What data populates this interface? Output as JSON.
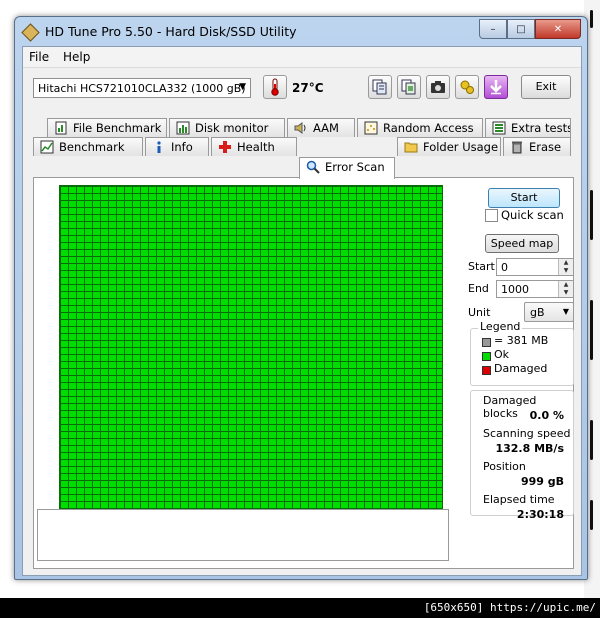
{
  "window": {
    "title": "HD Tune Pro 5.50 - Hard Disk/SSD Utility",
    "controls": {
      "minimize": "–",
      "maximize": "□",
      "close": "✕"
    }
  },
  "menu": {
    "file": "File",
    "help": "Help"
  },
  "toolbar": {
    "drive": "Hitachi HCS721010CLA332 (1000 gB)",
    "temperature": "27°C",
    "exit": "Exit",
    "icons": [
      "thermometer-icon",
      "copy-info-icon",
      "copy-screen-icon",
      "camera-icon",
      "options-icon",
      "save-icon"
    ]
  },
  "tabs": {
    "row1": [
      {
        "label": "File Benchmark",
        "icon": "file-benchmark-icon"
      },
      {
        "label": "Disk monitor",
        "icon": "disk-monitor-icon"
      },
      {
        "label": "AAM",
        "icon": "speaker-icon"
      },
      {
        "label": "Random Access",
        "icon": "random-access-icon"
      },
      {
        "label": "Extra tests",
        "icon": "extra-tests-icon"
      }
    ],
    "row2": [
      {
        "label": "Benchmark",
        "icon": "benchmark-icon"
      },
      {
        "label": "Info",
        "icon": "info-icon"
      },
      {
        "label": "Health",
        "icon": "health-cross-icon"
      },
      {
        "label": "Error Scan",
        "icon": "magnifier-icon"
      },
      {
        "label": "Folder Usage",
        "icon": "folder-icon"
      },
      {
        "label": "Erase",
        "icon": "trash-icon"
      }
    ],
    "active": "Error Scan"
  },
  "scan": {
    "start_button": "Start",
    "quick_scan": "Quick scan",
    "quick_scan_checked": false,
    "speed_map": "Speed map",
    "start_label": "Start",
    "start_value": "0",
    "end_label": "End",
    "end_value": "1000",
    "unit_label": "Unit",
    "unit_value": "gB",
    "block_color_ok": "#00dd00",
    "block_color_damaged": "#dd0000"
  },
  "legend": {
    "title": "Legend",
    "block_size": "= 381 MB",
    "ok": "Ok",
    "damaged": "Damaged"
  },
  "stats": {
    "damaged_blocks_label": "Damaged blocks",
    "damaged_blocks_value": "0.0 %",
    "scanning_speed_label": "Scanning speed",
    "scanning_speed_value": "132.8 MB/s",
    "position_label": "Position",
    "position_value": "999 gB",
    "elapsed_label": "Elapsed time",
    "elapsed_value": "2:30:18"
  },
  "log_text": "",
  "watermark": "[650x650] https://upic.me/"
}
